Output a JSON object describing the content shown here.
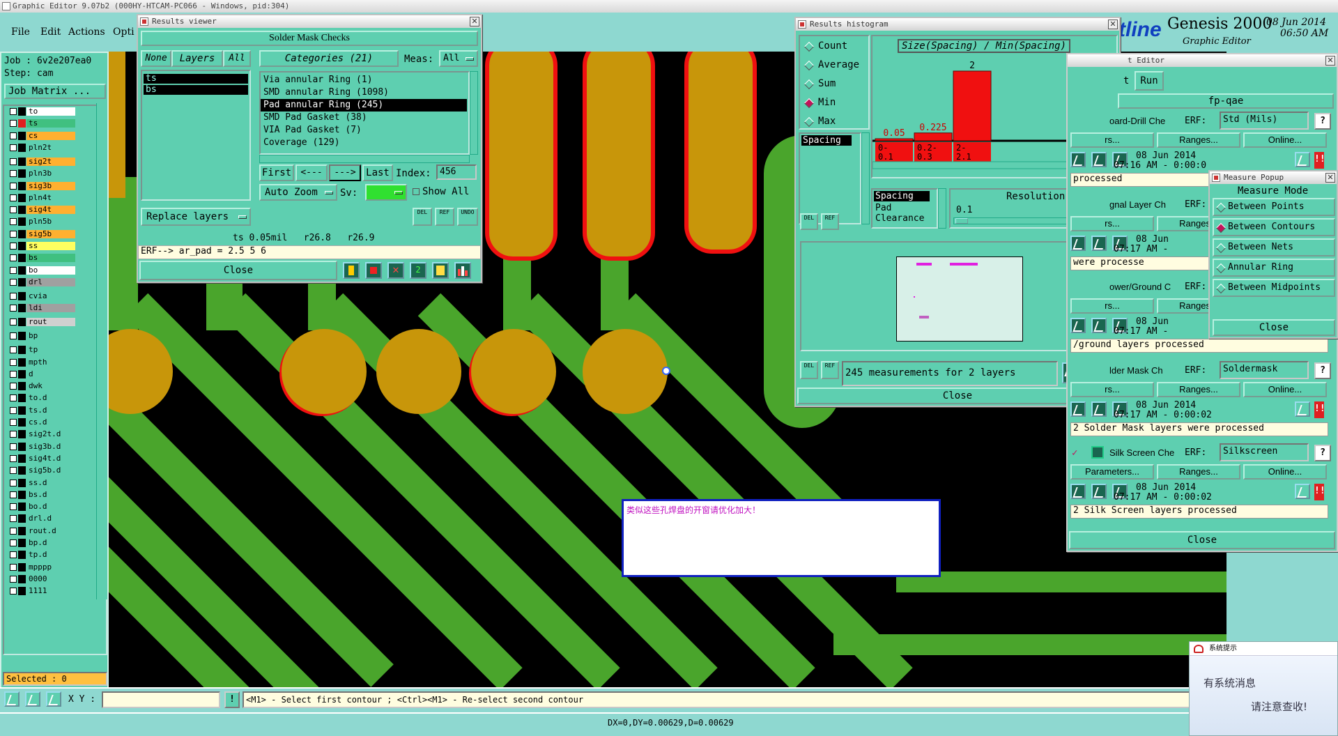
{
  "app": {
    "title": "Graphic Editor 9.07b2 (000HY-HTCAM-PC066 - Windows, pid:304)",
    "menu": [
      "File",
      "Edit",
      "Actions",
      "Opti"
    ],
    "brand_name": "Genesis 2000",
    "brand_sub": "Graphic Editor",
    "brand_logo_fragment": "tline",
    "date": "08 Jun 2014",
    "time": "06:50 AM"
  },
  "left": {
    "job": "Job : 6v2e207ea0",
    "step": "Step: cam",
    "job_matrix": "Job Matrix ...",
    "layers": [
      {
        "name": "to",
        "color": "#ffffff",
        "swatch": "#000000"
      },
      {
        "name": "ts",
        "color": "#40c080",
        "swatch": "#e02020",
        "mark": "⊡"
      },
      {
        "name": "cs",
        "color": "#ffb030",
        "swatch": "#000000",
        "mark": "⊡"
      },
      {
        "name": "pln2t",
        "color": "#5ecfb0",
        "swatch": "#000000"
      },
      {
        "name": "sig2t",
        "color": "#ffb030",
        "swatch": "#000000",
        "mark": "⬋"
      },
      {
        "name": "pln3b",
        "color": "#5ecfb0",
        "swatch": "#000000"
      },
      {
        "name": "sig3b",
        "color": "#ffb030",
        "swatch": "#000000",
        "mark": "⬋"
      },
      {
        "name": "pln4t",
        "color": "#5ecfb0",
        "swatch": "#000000"
      },
      {
        "name": "sig4t",
        "color": "#ffb030",
        "swatch": "#000000",
        "mark": "⬋"
      },
      {
        "name": "pln5b",
        "color": "#5ecfb0",
        "swatch": "#000000"
      },
      {
        "name": "sig5b",
        "color": "#ffb030",
        "swatch": "#000000"
      },
      {
        "name": "ss",
        "color": "#ffff60",
        "swatch": "#000000"
      },
      {
        "name": "bs",
        "color": "#40c080",
        "swatch": "#000000"
      },
      {
        "name": "bo",
        "color": "#ffffff",
        "swatch": "#000000"
      },
      {
        "name": "drl",
        "color": "#a0a0a0",
        "swatch": "#000000"
      },
      {
        "name": "cvia",
        "color": "#5ecfb0",
        "swatch": "#000000"
      },
      {
        "name": "ldi",
        "color": "#a0a0a0",
        "swatch": "#000000"
      },
      {
        "name": "rout",
        "color": "#d0d0d0",
        "swatch": "#000000"
      },
      {
        "name": "bp",
        "color": "#5ecfb0",
        "swatch": "#000000"
      },
      {
        "name": "tp",
        "color": "#5ecfb0",
        "swatch": "#000000"
      },
      {
        "name": "mpth",
        "color": "#5ecfb0",
        "swatch": "#000000"
      },
      {
        "name": "d",
        "color": "#5ecfb0",
        "swatch": "#000000"
      },
      {
        "name": "dwk",
        "color": "#5ecfb0",
        "swatch": "#000000"
      },
      {
        "name": "to.d",
        "color": "#5ecfb0",
        "swatch": "#000000"
      },
      {
        "name": "ts.d",
        "color": "#5ecfb0",
        "swatch": "#000000"
      },
      {
        "name": "cs.d",
        "color": "#5ecfb0",
        "swatch": "#000000",
        "mark": "⬋"
      },
      {
        "name": "sig2t.d",
        "color": "#5ecfb0",
        "swatch": "#000000",
        "mark": "⬋"
      },
      {
        "name": "sig3b.d",
        "color": "#5ecfb0",
        "swatch": "#000000",
        "mark": "⬋"
      },
      {
        "name": "sig4t.d",
        "color": "#5ecfb0",
        "swatch": "#000000",
        "mark": "⬋"
      },
      {
        "name": "sig5b.d",
        "color": "#5ecfb0",
        "swatch": "#000000"
      },
      {
        "name": "ss.d",
        "color": "#5ecfb0",
        "swatch": "#000000"
      },
      {
        "name": "bs.d",
        "color": "#5ecfb0",
        "swatch": "#000000"
      },
      {
        "name": "bo.d",
        "color": "#5ecfb0",
        "swatch": "#000000"
      },
      {
        "name": "drl.d",
        "color": "#5ecfb0",
        "swatch": "#000000"
      },
      {
        "name": "rout.d",
        "color": "#5ecfb0",
        "swatch": "#000000"
      },
      {
        "name": "bp.d",
        "color": "#5ecfb0",
        "swatch": "#000000"
      },
      {
        "name": "tp.d",
        "color": "#5ecfb0",
        "swatch": "#000000"
      },
      {
        "name": "mpppp",
        "color": "#5ecfb0",
        "swatch": "#000000"
      },
      {
        "name": "0000",
        "color": "#5ecfb0",
        "swatch": "#000000"
      },
      {
        "name": "1111",
        "color": "#5ecfb0",
        "swatch": "#000000"
      }
    ],
    "selected": "Selected : 0"
  },
  "results_viewer": {
    "title": "Results viewer",
    "header": "Solder Mask Checks",
    "none_btn": "None",
    "layers_btn": "Layers",
    "all_btn": "All",
    "layer_list": [
      "ts",
      "bs"
    ],
    "categories_btn": "Categories (21)",
    "meas_label": "Meas:",
    "meas_value": "All",
    "categories": [
      "Via annular Ring (1)",
      "SMD annular Ring (1098)",
      "Pad annular Ring (245)",
      "SMD Pad Gasket (38)",
      "VIA Pad Gasket (7)",
      "Coverage (129)"
    ],
    "selected_category": 2,
    "first": "First",
    "prev": "<---",
    "next": "--->",
    "last": "Last",
    "index_label": "Index:",
    "index_value": "456",
    "auto_zoom": "Auto Zoom",
    "sv_label": "Sv:",
    "show_all": "Show All",
    "replace_layers": "Replace layers",
    "del": "DEL",
    "ref": "REF",
    "undo": "UNDO",
    "status": "ts 0.05mil   r26.8   r26.9",
    "erf": "ERF--> ar_pad = 2.5 5 6",
    "close": "Close"
  },
  "histogram": {
    "title": "Results histogram",
    "options": [
      "Count",
      "Average",
      "Sum",
      "Min",
      "Max"
    ],
    "selected_option": "Min",
    "chart_title": "Size(Spacing) / Min(Spacing)",
    "top_value": "2",
    "labels_values": [
      "0.05",
      "0.225"
    ],
    "bins": [
      "0-\n  0.1",
      "0.2-\n  0.3",
      "2-\n  2.1"
    ],
    "list_item": "Spacing",
    "types": [
      "Spacing",
      "Pad",
      "Clearance"
    ],
    "resolution_label": "Resolution",
    "resolution_value": "0.1",
    "del": "DEL",
    "ref": "REF",
    "summary": "245 measurements for 2 layers",
    "close": "Close"
  },
  "chart_data": {
    "type": "bar",
    "title": "Size(Spacing) / Min(Spacing)",
    "categories": [
      "0-0.1",
      "0.2-0.3",
      "2-2.1"
    ],
    "values": [
      0.05,
      0.225,
      2
    ],
    "ylim": [
      0,
      2
    ]
  },
  "qae": {
    "title_frag": "t Editor",
    "run_frag": "t",
    "run": "Run",
    "header": "fp-qae",
    "checks": [
      {
        "name": "oard-Drill Che",
        "erf": "Std (Mils)",
        "date": "08 Jun 2014",
        "time": "07:16 AM - 0:00:0",
        "status": "processed"
      },
      {
        "name": "gnal Layer Ch",
        "erf": "",
        "date": "08 Jun",
        "time": "07:17 AM -",
        "status": "were processe"
      },
      {
        "name": "ower/Ground C",
        "erf": "",
        "date": "08 Jun",
        "time": "07:17 AM -",
        "status": "/ground layers processed"
      },
      {
        "name": "lder Mask Ch",
        "erf": "Soldermask",
        "date": "08 Jun 2014",
        "time": "07:17 AM - 0:00:02",
        "status": "2 Solder Mask layers were processed"
      },
      {
        "name": "Silk Screen Che",
        "erf": "Silkscreen",
        "date": "08 Jun 2014",
        "time": "07:17 AM - 0:00:02",
        "status": "2 Silk Screen layers processed"
      }
    ],
    "erf_label": "ERF:",
    "params": "rs...",
    "params_full": "Parameters...",
    "ranges": "Ranges...",
    "online": "Online...",
    "close": "Close"
  },
  "measure": {
    "title": "Measure Popup",
    "mode_label": "Measure Mode",
    "modes": [
      "Between Points",
      "Between Contours",
      "Between Nets",
      "Annular Ring",
      "Between Midpoints"
    ],
    "selected_mode": "Between Contours",
    "close": "Close"
  },
  "note": {
    "text": "类似这些孔焊盘的开窗请优化加大！"
  },
  "status_bar": {
    "xy_label": "X Y :",
    "prompt": "<M1> - Select first contour ; <Ctrl><M1> - Re-select second contour",
    "coords": "DX=0,DY=0.00629,D=0.00629"
  },
  "sys_notify": {
    "title": "系统提示",
    "line1": "有系统消息",
    "line2": "请注意查收!"
  }
}
